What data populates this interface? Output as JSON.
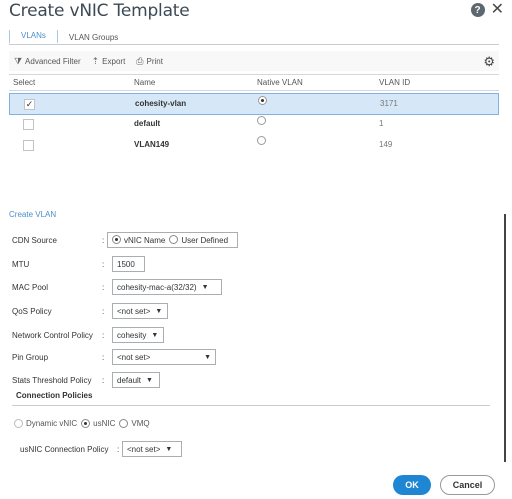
{
  "dialog": {
    "title": "Create vNIC Template",
    "help_label": "?",
    "close_label": "✕"
  },
  "tabs": [
    {
      "label": "VLANs"
    },
    {
      "label": "VLAN Groups"
    }
  ],
  "toolbar": {
    "advanced_filter": "Advanced Filter",
    "export": "Export",
    "print": "Print"
  },
  "table": {
    "headers": {
      "select": "Select",
      "name": "Name",
      "native_vlan": "Native VLAN",
      "vlan_id": "VLAN ID"
    },
    "rows": [
      {
        "checked": "✓",
        "name": "cohesity-vlan",
        "native": true,
        "vlan_id": "3171"
      },
      {
        "checked": "",
        "name": "default",
        "native": false,
        "vlan_id": "1"
      },
      {
        "checked": "",
        "name": "VLAN149",
        "native": false,
        "vlan_id": "149"
      }
    ]
  },
  "create_vlan": {
    "section_title": "Create VLAN",
    "colon": ":",
    "cdn_source": {
      "label": "CDN Source",
      "opt1": "vNIC Name",
      "opt2": "User Defined"
    },
    "mtu": {
      "label": "MTU",
      "value": "1500"
    },
    "mac_pool": {
      "label": "MAC Pool",
      "value": "cohesity-mac-a(32/32)"
    },
    "qos_policy": {
      "label": "QoS Policy",
      "value": "<not set>"
    },
    "network_control_policy": {
      "label": "Network Control Policy",
      "value": "cohesity"
    },
    "pin_group": {
      "label": "Pin Group",
      "value": "<not set>"
    },
    "stats_threshold_policy": {
      "label": "Stats Threshold Policy",
      "value": "default"
    },
    "connection_policies": {
      "title": "Connection Policies",
      "opt1": "Dynamic vNIC",
      "opt2": "usNIC",
      "opt3": "VMQ",
      "usnic_label": "usNIC Connection Policy",
      "usnic_value": "<not set>"
    }
  },
  "buttons": {
    "ok": "OK",
    "cancel": "Cancel"
  }
}
